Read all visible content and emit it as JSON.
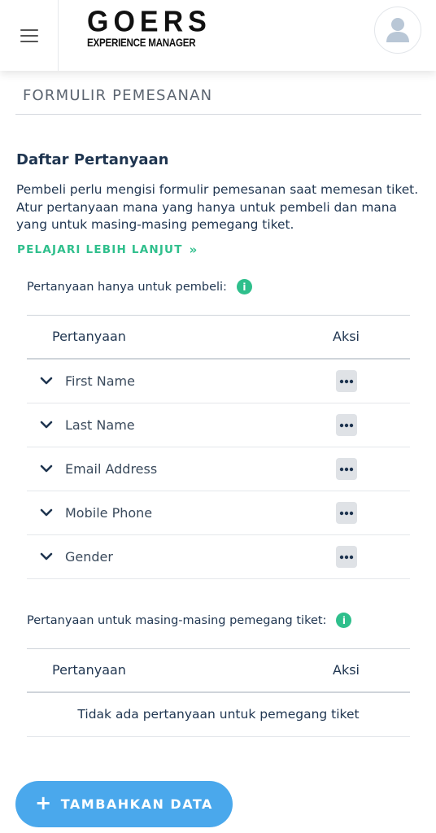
{
  "header": {
    "logo_main": "GOERS",
    "logo_sub": "EXPERIENCE MANAGER"
  },
  "section": {
    "title": "FORMULIR PEMESANAN"
  },
  "questions": {
    "heading": "Daftar Pertanyaan",
    "description": "Pembeli perlu mengisi formulir pemesanan saat memesan tiket. Atur pertanyaan mana yang hanya untuk pembeli dan mana yang untuk masing-masing pemegang tiket.",
    "learn_more": "PELAJARI LEBIH LANJUT"
  },
  "buyer_table": {
    "label": "Pertanyaan hanya untuk pembeli:",
    "col_question": "Pertanyaan",
    "col_action": "Aksi",
    "rows": [
      "First Name",
      "Last Name",
      "Email Address",
      "Mobile Phone",
      "Gender"
    ]
  },
  "holder_table": {
    "label": "Pertanyaan untuk masing-masing pemegang tiket:",
    "col_question": "Pertanyaan",
    "col_action": "Aksi",
    "empty_text": "Tidak ada pertanyaan untuk pemegang tiket"
  },
  "add_button": {
    "label": "TAMBAHKAN DATA"
  },
  "colors": {
    "accent_green": "#2fbf8c",
    "button_blue": "#4aa8ec",
    "text_dark": "#1f3550"
  }
}
